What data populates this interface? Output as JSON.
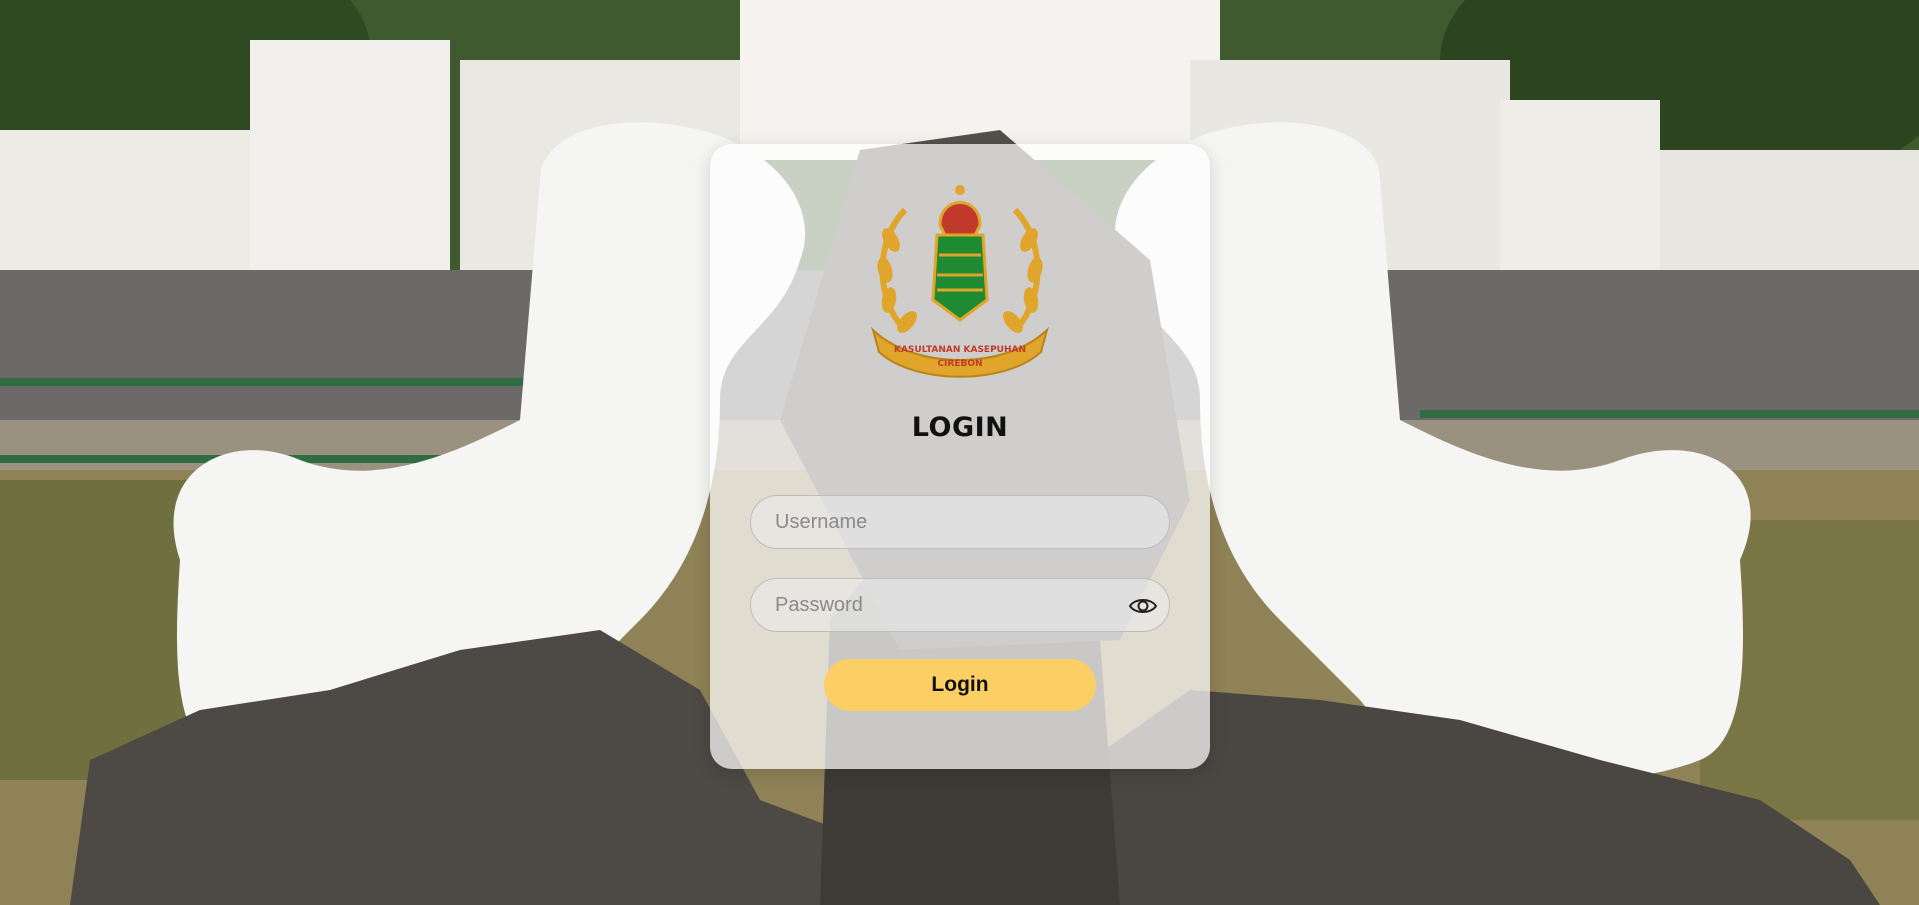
{
  "colors": {
    "accent": "#fbcf63",
    "card_bg": "rgba(255,255,255,0.72)",
    "logo_gold": "#e0a52a",
    "logo_red": "#c0392b",
    "logo_green": "#1e8a32"
  },
  "logo": {
    "ribbon_text_line1": "KASULTANAN KASEPUHAN",
    "ribbon_text_line2": "CIREBON"
  },
  "login": {
    "title": "LOGIN",
    "username_placeholder": "Username",
    "username_value": "",
    "password_placeholder": "Password",
    "password_value": "",
    "toggle_icon": "eye-icon",
    "submit_label": "Login"
  }
}
